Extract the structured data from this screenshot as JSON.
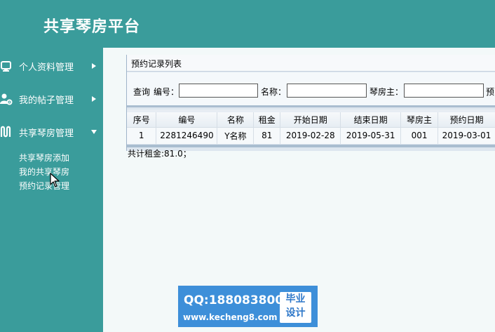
{
  "app": {
    "title": "共享琴房平台"
  },
  "sidebar": {
    "menus": [
      {
        "label": "个人资料管理",
        "icon": "monitor-icon",
        "expanded": false
      },
      {
        "label": "我的帖子管理",
        "icon": "user-settings-icon",
        "expanded": false
      },
      {
        "label": "共享琴房管理",
        "icon": "music-icon",
        "expanded": true
      }
    ],
    "submenu": [
      {
        "label": "共享琴房添加"
      },
      {
        "label": "我的共享琴房"
      },
      {
        "label": "预约记录管理"
      }
    ]
  },
  "panel": {
    "title": "预约记录列表",
    "search": {
      "query_label": "查询",
      "fields": [
        {
          "label": "编号：",
          "value": ""
        },
        {
          "label": "名称：",
          "value": ""
        },
        {
          "label": "琴房主：",
          "value": ""
        }
      ],
      "trailing_label": "预"
    },
    "table": {
      "columns": [
        "序号",
        "编号",
        "名称",
        "租金",
        "开始日期",
        "结束日期",
        "琴房主",
        "预约日期"
      ],
      "rows": [
        [
          "1",
          "2281246490",
          "Y名称",
          "81",
          "2019-02-28",
          "2019-05-31",
          "001",
          "2019-03-01"
        ]
      ]
    },
    "total": "共计租金:81.0；"
  },
  "watermark": {
    "qq": "QQ:188083800",
    "url": "www.kecheng8.com",
    "badge_line1": "毕业",
    "badge_line2": "设计"
  },
  "colors": {
    "header_bg": "#3a9c9b",
    "content_bg": "#f3f9f9",
    "watermark_bg": "#3d8fd9"
  }
}
